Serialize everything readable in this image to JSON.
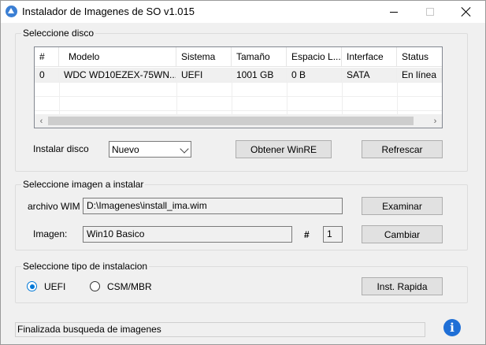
{
  "window": {
    "title": "Instalador de Imagenes de SO v1.015",
    "icon": "app-logo-icon"
  },
  "disk_group": {
    "title": "Seleccione disco",
    "columns": [
      "#",
      "Modelo",
      "Sistema",
      "Tamaño",
      "Espacio L...",
      "Interface",
      "Status"
    ],
    "rows": [
      [
        "0",
        "WDC WD10EZEX-75WN...",
        "UEFI",
        "1001 GB",
        "0 B",
        "SATA",
        "En línea"
      ]
    ],
    "install_label": "Instalar disco",
    "install_value": "Nuevo",
    "winre_button": "Obtener WinRE",
    "refresh_button": "Refrescar"
  },
  "image_group": {
    "title": "Seleccione imagen a instalar",
    "wim_label": "archivo WIM",
    "wim_value": "D:\\Imagenes\\install_ima.wim",
    "browse_button": "Examinar",
    "image_label": "Imagen:",
    "image_value": "Win10 Basico",
    "index_label": "#",
    "index_value": "1",
    "change_button": "Cambiar"
  },
  "install_type_group": {
    "title": "Seleccione tipo de instalacion",
    "options": [
      "UEFI",
      "CSM/MBR"
    ],
    "selected": "UEFI",
    "quick_button": "Inst. Rapida"
  },
  "status": {
    "text": "Finalizada busqueda de imagenes",
    "icon": "info-icon"
  },
  "colors": {
    "accent": "#0078d7",
    "info": "#1f6fd6"
  }
}
